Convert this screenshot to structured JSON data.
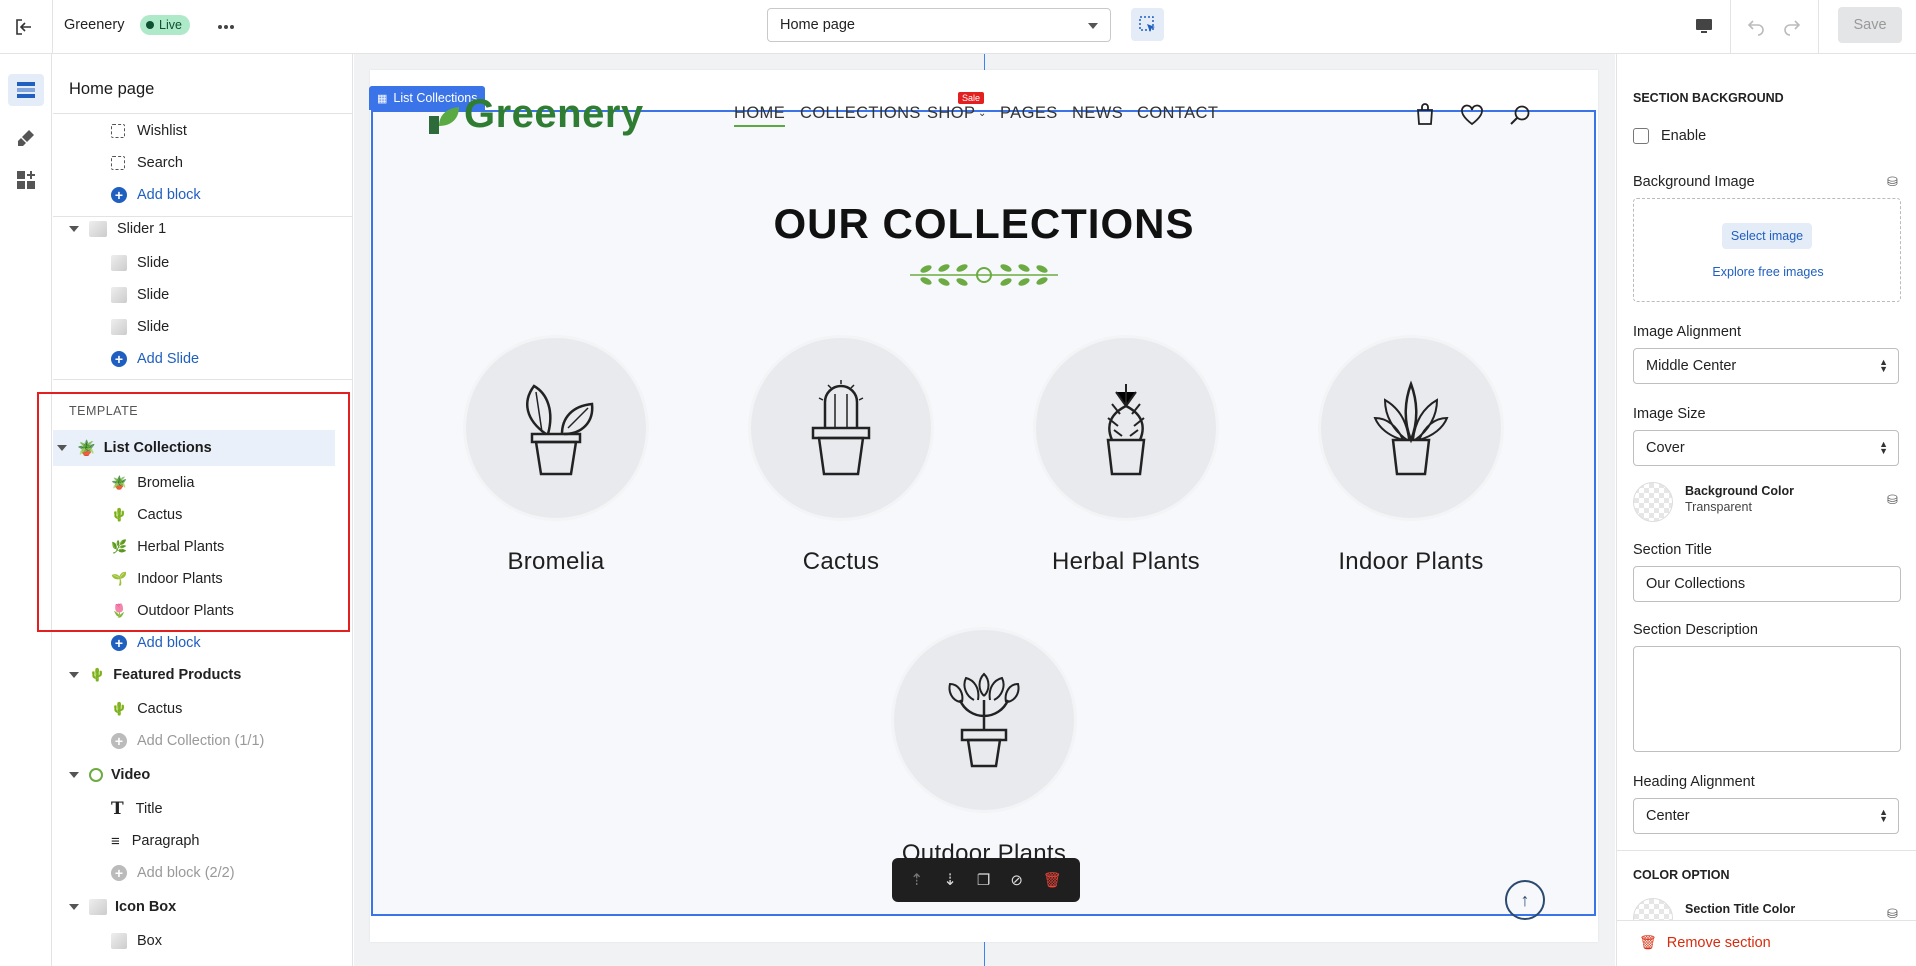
{
  "topbar": {
    "store_name": "Greenery",
    "live_badge": "Live",
    "page_select": "Home page",
    "save_label": "Save"
  },
  "tree": {
    "title": "Home page",
    "header_blocks": [
      "Wishlist",
      "Search"
    ],
    "add_block": "Add block",
    "slider": {
      "label": "Slider 1",
      "items": [
        "Slide",
        "Slide",
        "Slide"
      ],
      "add": "Add Slide"
    },
    "template_label": "TEMPLATE",
    "list_collections": {
      "label": "List Collections",
      "items": [
        "Bromelia",
        "Cactus",
        "Herbal Plants",
        "Indoor Plants",
        "Outdoor Plants"
      ],
      "add": "Add block"
    },
    "featured_products": {
      "label": "Featured Products",
      "items": [
        "Cactus"
      ],
      "add": "Add Collection (1/1)"
    },
    "video": {
      "label": "Video",
      "items": [
        "Title",
        "Paragraph"
      ],
      "add": "Add block (2/2)"
    },
    "icon_box": {
      "label": "Icon Box",
      "items": [
        "Box"
      ]
    }
  },
  "canvas": {
    "section_tag": "List Collections",
    "logo_text": "Greenery",
    "nav": [
      "HOME",
      "COLLECTIONS",
      "SHOP",
      "PAGES",
      "NEWS",
      "CONTACT"
    ],
    "sale_badge": "Sale",
    "heading": "OUR COLLECTIONS",
    "collections": [
      "Bromelia",
      "Cactus",
      "Herbal Plants",
      "Indoor Plants",
      "Outdoor Plants"
    ]
  },
  "props": {
    "section_background": "SECTION BACKGROUND",
    "enable_label": "Enable",
    "bg_image_label": "Background Image",
    "select_image": "Select image",
    "explore_images": "Explore free images",
    "image_alignment_label": "Image Alignment",
    "image_alignment_value": "Middle Center",
    "image_size_label": "Image Size",
    "image_size_value": "Cover",
    "bg_color_label": "Background Color",
    "bg_color_value": "Transparent",
    "section_title_label": "Section Title",
    "section_title_value": "Our Collections",
    "section_desc_label": "Section Description",
    "heading_alignment_label": "Heading Alignment",
    "heading_alignment_value": "Center",
    "color_option": "COLOR OPTION",
    "section_title_color": "Section Title Color",
    "remove_section": "Remove section"
  },
  "colors": {
    "accent": "#1f5fbf",
    "brand_green": "#2e7d32",
    "danger": "#d72c0d",
    "selection": "#e32020"
  }
}
